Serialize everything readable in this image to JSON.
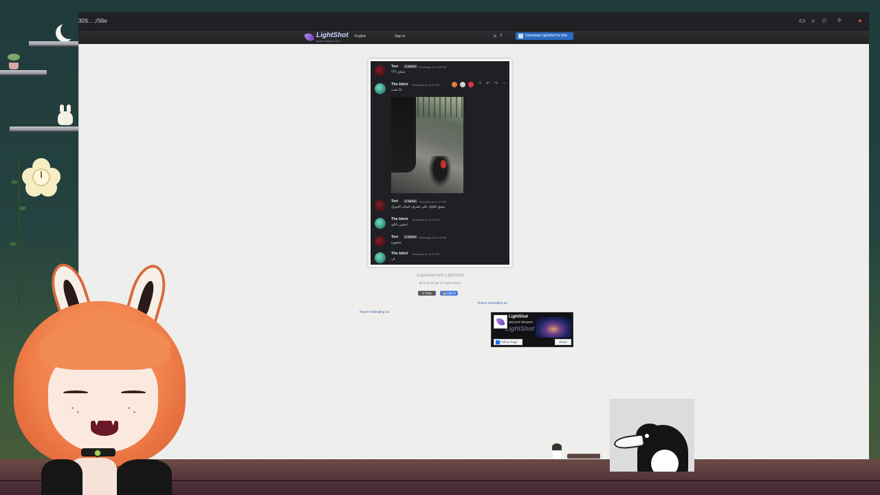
{
  "browser": {
    "tab_title": "30S... ;/S6e",
    "toolbar_icons": [
      "cast-icon",
      "zoom-icon",
      "bookmark-star-icon",
      "extensions-icon",
      "profile-icon"
    ]
  },
  "lightshot": {
    "brand": "LightShot",
    "tagline": "screen capture tool",
    "language": "English",
    "sign_in": "Sign in",
    "download_label": "Download Lightshot for free",
    "social_icons": [
      "twitter-icon",
      "facebook-icon"
    ],
    "captured_with": "Captured with Lightshot",
    "image_links": "▤ Print similar  ⊘ report abuse",
    "post_button": "X Post",
    "like_button": "👍 Like 0",
    "report_ad_left": "Report misleading ad",
    "report_ad_right": "Report misleading ad",
    "fb_widget": {
      "page_name": "LightShot",
      "followers": "363,019 followers",
      "follow_label": "Follow Page",
      "share_label": "Share",
      "watermark": "LightShot"
    }
  },
  "screenshot": {
    "messages": [
      {
        "name": "Tori",
        "badge": "✔ NERD",
        "time": "Yesterday at 11:05 PM",
        "text": "تحتاج ؟؟؟"
      },
      {
        "name": "The bitch",
        "badge": "",
        "time": "Yesterday at 11:11 PM",
        "text": "انا ثحت"
      },
      {
        "name": "Tori",
        "badge": "✔ NERD",
        "time": "Yesterday at 11:12 PM",
        "text": "مسح علاؤك على تشرف اسنان المريل"
      },
      {
        "name": "The bitch",
        "badge": "",
        "time": "Yesterday at 11:14 PM",
        "text": "امشي باتاي"
      },
      {
        "name": "Tori",
        "badge": "✔ NERD",
        "time": "Yesterday at 11:15 PM",
        "text": "مشوره"
      },
      {
        "name": "The bitch",
        "badge": "",
        "time": "Yesterday at 11:20 PM",
        "text": "ف"
      }
    ],
    "hover_actions": [
      "emoji-react-icon",
      "skull-react-icon",
      "heart-react-icon",
      "add-reaction-icon",
      "reply-icon",
      "forward-icon",
      "more-icon"
    ]
  },
  "colors": {
    "discord_bg": "#1f2023",
    "page_bg": "#eeeeec",
    "download_button": "#2b6cc4",
    "header": "#2a2a2c"
  }
}
